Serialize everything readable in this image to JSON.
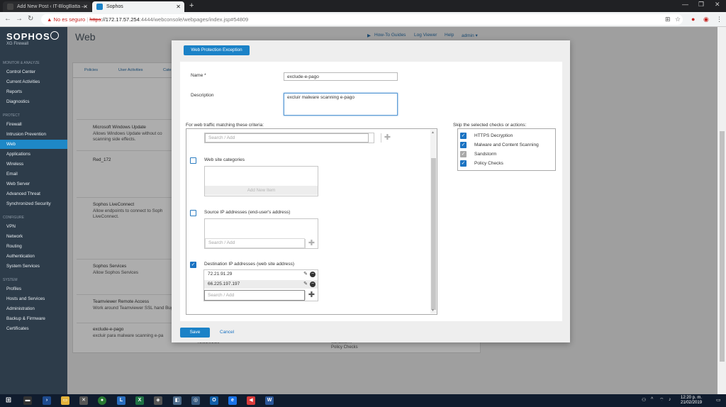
{
  "browser": {
    "tabs": [
      {
        "label": "Add New Post ‹ IT-BlogBatta — W",
        "active": false
      },
      {
        "label": "Sophos",
        "active": true
      }
    ],
    "address": {
      "warning": "No es seguro",
      "scheme": "https",
      "host": "://172.17.57.254",
      "path": ":4444/webconsole/webpages/index.jsp#54809"
    }
  },
  "sidebar": {
    "brand": "SOPHOS",
    "brand_sub": "XG Firewall",
    "sections": [
      {
        "heading": "MONITOR & ANALYZE",
        "items": [
          "Control Center",
          "Current Activities",
          "Reports",
          "Diagnostics"
        ]
      },
      {
        "heading": "PROTECT",
        "items": [
          "Firewall",
          "Intrusion Prevention",
          "Web",
          "Applications",
          "Wireless",
          "Email",
          "Web Server",
          "Advanced Threat",
          "Synchronized Security"
        ]
      },
      {
        "heading": "CONFIGURE",
        "items": [
          "VPN",
          "Network",
          "Routing",
          "Authentication",
          "System Services"
        ]
      },
      {
        "heading": "SYSTEM",
        "items": [
          "Profiles",
          "Hosts and Services",
          "Administration",
          "Backup & Firmware",
          "Certificates"
        ]
      }
    ],
    "active_item": "Web"
  },
  "header": {
    "page_title": "Web",
    "links": [
      "How-To Guides",
      "Log Viewer",
      "Help"
    ],
    "user": "admin"
  },
  "background": {
    "tabs": [
      "Policies",
      "User Activities",
      "Cate"
    ],
    "rows": [
      {
        "title": "Microsoft Windows Update",
        "desc": "Allows Windows Update without co scanning side effects."
      },
      {
        "title": "Red_172",
        "desc": ""
      },
      {
        "title": "Sophos LiveConnect",
        "desc": "Allow endpoints to connect to Soph LiveConnect."
      },
      {
        "title": "Sophos Services",
        "desc": "Allow Sophos Services"
      },
      {
        "title": "Teamviewer Remote Access",
        "desc": "Work around Teamviewer SSL hand Bug."
      },
      {
        "title": "exclude-e-pago",
        "desc": "excluir para malware scanning e-pa"
      }
    ],
    "ip": "72.21.91.29",
    "extra": [
      "Sandstorm",
      "Policy Checks"
    ]
  },
  "modal": {
    "title": "Web Protection Exception",
    "name_label": "Name *",
    "name_value": "exclude-e-pago",
    "description_label": "Description",
    "description_value": "excluir malware scanning e-pago",
    "criteria_label": "For web traffic matching these criteria:",
    "top_search_placeholder": "Search / Add",
    "categories_label": "Web site categories",
    "add_new_item": "Add New Item",
    "source_label": "Source IP addresses (end-user's address)",
    "source_placeholder": "Search / Add",
    "dest_label": "Destination IP addresses (web site address)",
    "dest_ips": [
      "72.21.91.29",
      "66.225.197.197"
    ],
    "dest_placeholder": "Search / Add",
    "skip_label": "Skip the selected checks or actions:",
    "skip_items": [
      "HTTPS Decryption",
      "Malware and Content Scanning",
      "Sandstorm",
      "Policy Checks"
    ],
    "save": "Save",
    "cancel": "Cancel"
  },
  "taskbar": {
    "time": "12:20 p. m.",
    "date": "21/02/2019"
  }
}
